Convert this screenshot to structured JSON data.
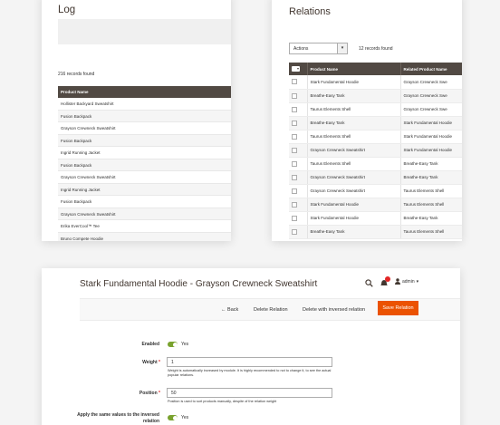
{
  "log": {
    "title": "Log",
    "records_found": "216 records found",
    "column_header": "Product Name",
    "rows": [
      "Hollister Backyard Sweatshirt",
      "Fusion Backpack",
      "Grayson Crewneck Sweatshirt",
      "Fusion Backpack",
      "Ingrid Running Jacket",
      "Fusion Backpack",
      "Grayson Crewneck Sweatshirt",
      "Ingrid Running Jacket",
      "Fusion Backpack",
      "Grayson Crewneck Sweatshirt",
      "Erika EverCool&trade; Tee",
      "Bruno Compete Hoodie"
    ]
  },
  "relations": {
    "title": "Relations",
    "actions_label": "Actions",
    "records_found": "12 records found",
    "columns": [
      "Product Name",
      "Related Product Name"
    ],
    "rows": [
      [
        "Stark Fundamental Hoodie",
        "Grayson Crewneck Swe"
      ],
      [
        "Breathe-Easy Tank",
        "Grayson Crewneck Swe"
      ],
      [
        "Taurus Elements Shell",
        "Grayson Crewneck Swe"
      ],
      [
        "Breathe-Easy Tank",
        "Stark Fundamental Hoodie"
      ],
      [
        "Taurus Elements Shell",
        "Stark Fundamental Hoodie"
      ],
      [
        "Grayson Crewneck Sweatshirt",
        "Stark Fundamental Hoodie"
      ],
      [
        "Taurus Elements Shell",
        "Breathe-Easy Tank"
      ],
      [
        "Grayson Crewneck Sweatshirt",
        "Breathe-Easy Tank"
      ],
      [
        "Grayson Crewneck Sweatshirt",
        "Taurus Elements Shell"
      ],
      [
        "Stark Fundamental Hoodie",
        "Taurus Elements Shell"
      ],
      [
        "Stark Fundamental Hoodie",
        "Breathe-Easy Tank"
      ],
      [
        "Breathe-Easy Tank",
        "Taurus Elements Shell"
      ]
    ]
  },
  "edit": {
    "title": "Stark Fundamental Hoodie - Grayson Crewneck Sweatshirt",
    "user": "admin",
    "notification_count": "2",
    "toolbar": {
      "back": "Back",
      "delete": "Delete Relation",
      "delete_inversed": "Delete with inversed relation",
      "save": "Save Relation"
    },
    "form": {
      "enabled_label": "Enabled",
      "enabled_value": "Yes",
      "weight_label": "Weight",
      "weight_value": "1",
      "weight_note": "Weight is automatically increased by module. It is highly recommended to not to change it, to see the actual popular relations.",
      "position_label": "Position",
      "position_value": "50",
      "position_note": "Position is used to sort products manually, despite of the relation weight",
      "apply_label": "Apply the same values to the inversed relation",
      "apply_value": "Yes"
    }
  },
  "colors": {
    "header_bg": "#514943",
    "accent": "#eb5202",
    "toggle_on": "#79a22e"
  }
}
